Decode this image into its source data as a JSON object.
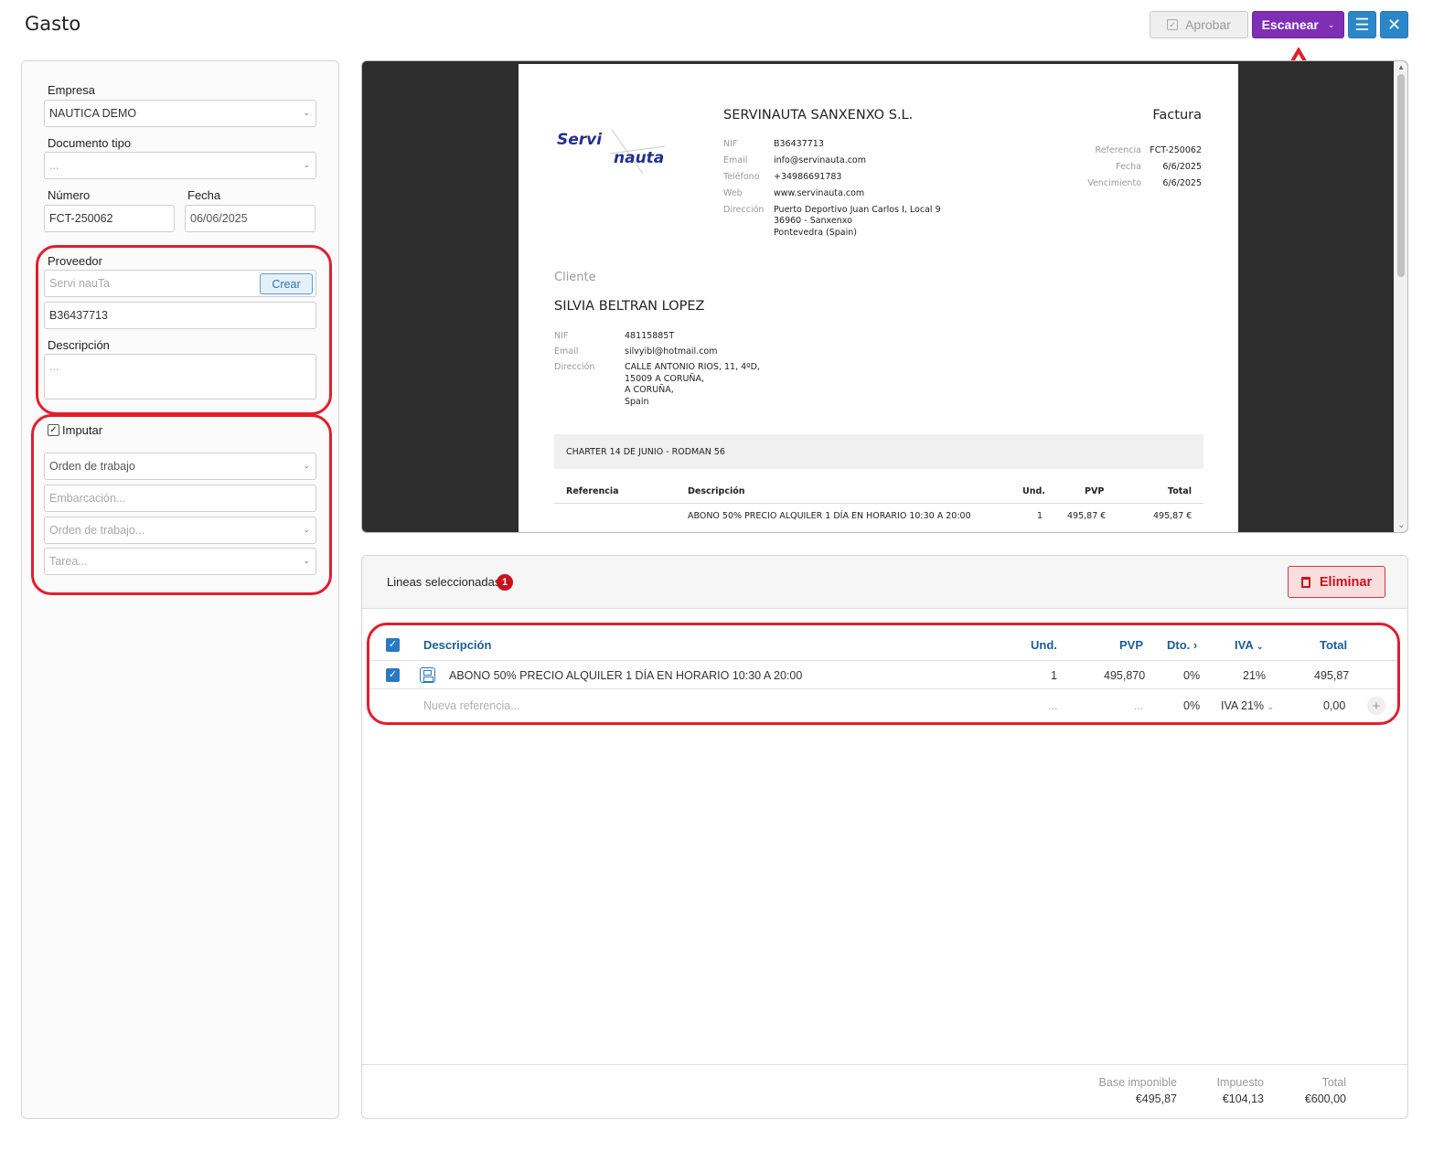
{
  "page": {
    "title": "Gasto"
  },
  "toolbar": {
    "approve_label": "Aprobar",
    "scan_label": "Escanear",
    "menu_icon": "hamburger-icon",
    "close_icon": "close-icon"
  },
  "form": {
    "empresa": {
      "label": "Empresa",
      "value": "NAUTICA DEMO"
    },
    "documento_tipo": {
      "label": "Documento tipo",
      "value": "..."
    },
    "numero": {
      "label": "Número",
      "value": "FCT-250062"
    },
    "fecha": {
      "label": "Fecha",
      "value": "06/06/2025"
    },
    "proveedor": {
      "label": "Proveedor",
      "placeholder": "Servi nauTa",
      "create_label": "Crear",
      "nif": "B36437713"
    },
    "descripcion": {
      "label": "Descripción",
      "placeholder": "..."
    },
    "imputar": {
      "label": "Imputar",
      "checked": true,
      "orden_trabajo": "Orden de trabajo",
      "embarcacion_placeholder": "Embarcación...",
      "orden_trabajo_placeholder": "Orden de trabajo...",
      "tarea_placeholder": "Tarea..."
    }
  },
  "invoice": {
    "company": "SERVINAUTA SANXENXO S.L.",
    "doc_type": "Factura",
    "logo": {
      "line1": "Servi",
      "line2": "nauta"
    },
    "issuer": {
      "nif_label": "NIF",
      "nif": "B36437713",
      "email_label": "Email",
      "email": "info@servinauta.com",
      "phone_label": "Teléfono",
      "phone": "+34986691783",
      "web_label": "Web",
      "web": "www.servinauta.com",
      "address_label": "Dirección",
      "address1": "Puerto Deportivo Juan Carlos I, Local 9",
      "address2": "36960 - Sanxenxo",
      "address3": "Pontevedra (Spain)"
    },
    "meta": {
      "ref_label": "Referencia",
      "ref": "FCT-250062",
      "date_label": "Fecha",
      "date": "6/6/2025",
      "due_label": "Vencimiento",
      "due": "6/6/2025"
    },
    "client": {
      "heading": "Cliente",
      "name": "SILVIA BELTRAN LOPEZ",
      "nif_label": "NIF",
      "nif": "48115885T",
      "email_label": "Email",
      "email": "silvyibl@hotmail.com",
      "address_label": "Dirección",
      "address1": "CALLE ANTONIO RIOS, 11, 4ºD,",
      "address2": "15009 A CORUÑA,",
      "address3": "A CORUÑA,",
      "address4": "Spain"
    },
    "charter": "CHARTER 14 DE JUNIO - RODMAN 56",
    "table_headers": {
      "ref": "Referencia",
      "desc": "Descripción",
      "und": "Und.",
      "pvp": "PVP",
      "total": "Total"
    },
    "row": {
      "desc": "ABONO 50% PRECIO ALQUILER 1 DÍA EN HORARIO 10:30 A 20:00",
      "und": "1",
      "pvp": "495,87 €",
      "total": "495,87 €"
    }
  },
  "lines": {
    "title": "Lineas seleccionadas",
    "selected_count": "1",
    "delete_label": "Eliminar",
    "headers": {
      "desc": "Descripción",
      "und": "Und.",
      "pvp": "PVP",
      "dto": "Dto.",
      "iva": "IVA",
      "total": "Total"
    },
    "row": {
      "desc": "ABONO 50% PRECIO ALQUILER 1 DÍA EN HORARIO 10:30 A 20:00",
      "und": "1",
      "pvp": "495,870",
      "dto": "0%",
      "iva": "21%",
      "total": "495,87"
    },
    "new_row": {
      "placeholder": "Nueva referencia...",
      "und": "...",
      "pvp": "...",
      "dto": "0%",
      "iva": "IVA 21%",
      "total": "0,00"
    }
  },
  "totals": {
    "base_label": "Base imponible",
    "base": "€495,87",
    "tax_label": "Impuesto",
    "tax": "€104,13",
    "total_label": "Total",
    "total": "€600,00"
  },
  "colors": {
    "accent": "#7e2fb5",
    "primary": "#2b87c8",
    "danger": "#c8121f",
    "annotation": "#e01f2e"
  }
}
